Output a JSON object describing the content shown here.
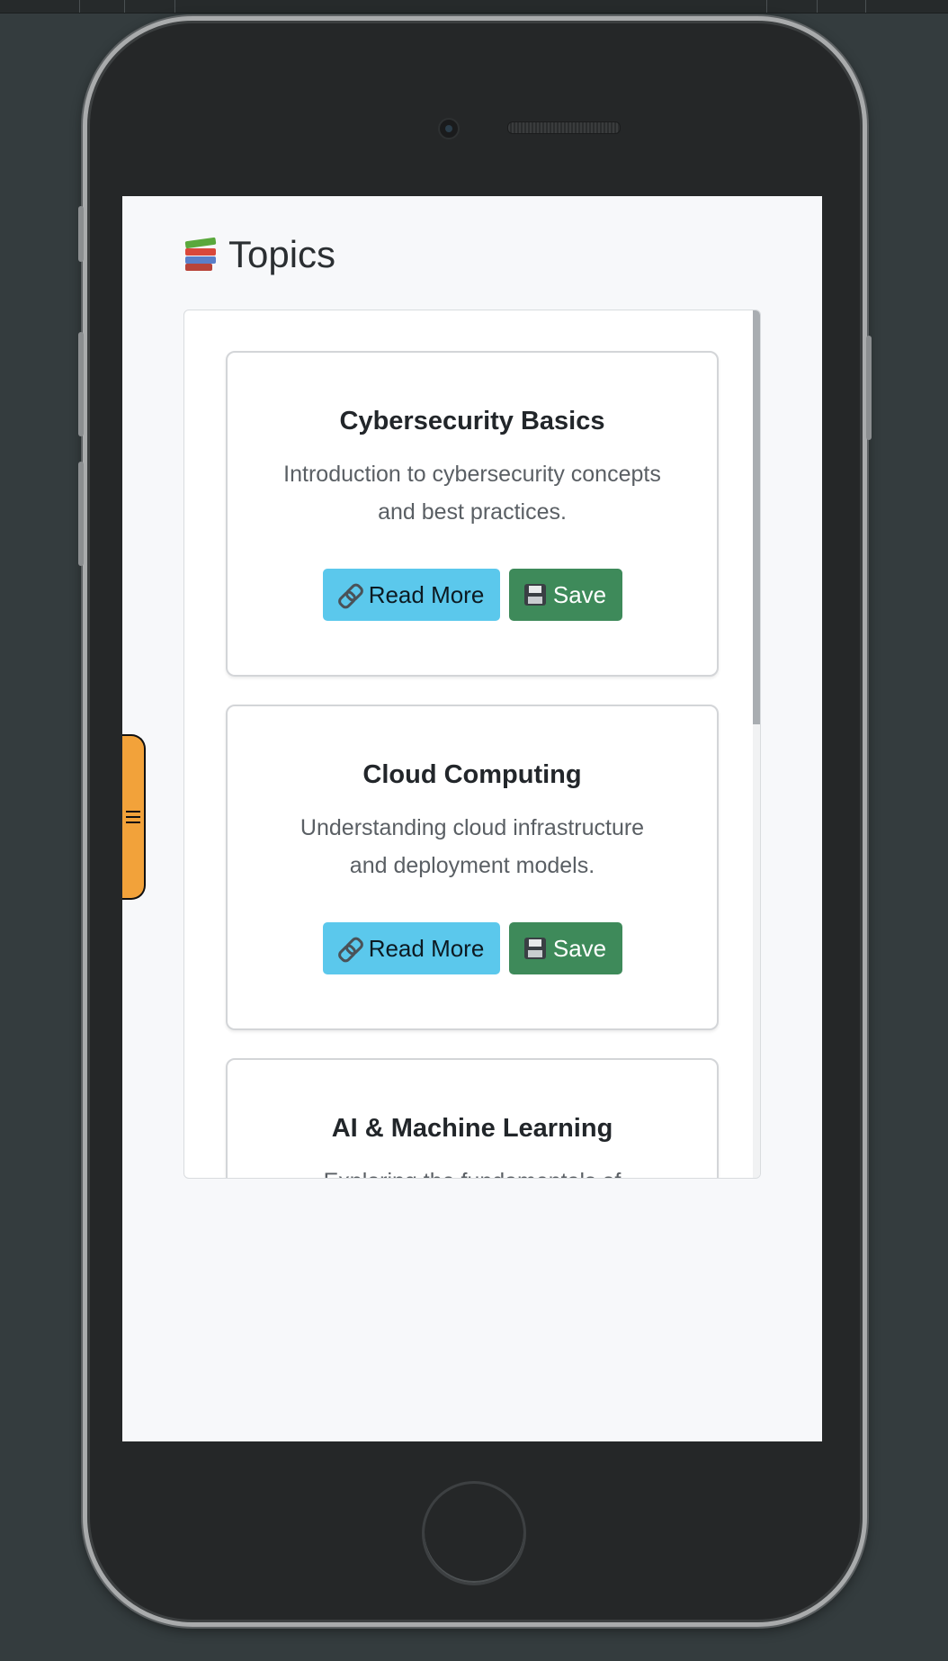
{
  "page": {
    "title": "Topics",
    "title_icon": "books-icon"
  },
  "drawer": {
    "toggle_icon": "hamburger-icon"
  },
  "cards": [
    {
      "title": "Cybersecurity Basics",
      "description": "Introduction to cybersecurity concepts and best practices.",
      "read_more_label": "Read More",
      "save_label": "Save"
    },
    {
      "title": "Cloud Computing",
      "description": "Understanding cloud infrastructure and deployment models.",
      "read_more_label": "Read More",
      "save_label": "Save"
    },
    {
      "title": "AI & Machine Learning",
      "description": "Exploring the fundamentals of"
    }
  ],
  "colors": {
    "read_more_button": "#5bc8ec",
    "save_button": "#3e8a5a",
    "drawer_tab": "#f2a23a",
    "background": "#343c3e"
  }
}
